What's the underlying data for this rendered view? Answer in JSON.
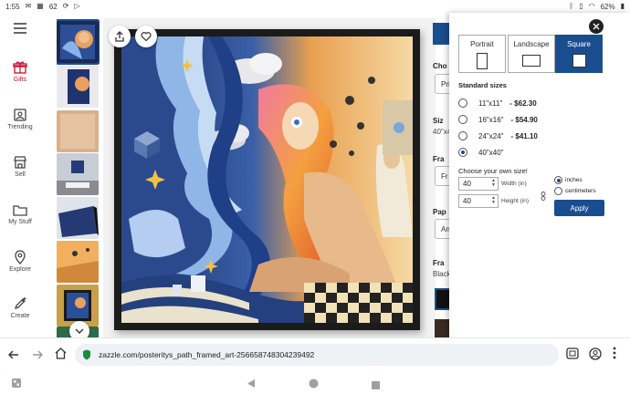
{
  "status": {
    "time": "1:55",
    "notif_count": "62",
    "battery": "62%"
  },
  "rail": {
    "items": [
      {
        "label": "Gifts",
        "icon": "gift-icon"
      },
      {
        "label": "Trending",
        "icon": "trending-icon"
      },
      {
        "label": "Sell",
        "icon": "store-icon"
      },
      {
        "label": "My Stuff",
        "icon": "folder-icon"
      },
      {
        "label": "Explore",
        "icon": "location-icon"
      },
      {
        "label": "Create",
        "icon": "pencil-icon"
      }
    ]
  },
  "product_options": {
    "labels": [
      "Cho",
      "Siz",
      "Fra",
      "Pap",
      "Fra"
    ],
    "values": [
      "Pri",
      "40\"x4",
      "Fr",
      "An",
      "Black"
    ]
  },
  "panel": {
    "orientations": [
      {
        "label": "Portrait",
        "selected": false
      },
      {
        "label": "Landscape",
        "selected": false
      },
      {
        "label": "Square",
        "selected": true
      }
    ],
    "standard_title": "Standard sizes",
    "sizes": [
      {
        "size": "11\"x11\"",
        "price": "- $62.30",
        "selected": false
      },
      {
        "size": "16\"x16\"",
        "price": "- $54.90",
        "selected": false
      },
      {
        "size": "24\"x24\"",
        "price": "- $41.10",
        "selected": false
      },
      {
        "size": "40\"x40\"",
        "price": "",
        "selected": true
      }
    ],
    "own_title": "Choose your own size!",
    "width_value": "40",
    "width_label": "Width (in)",
    "height_value": "40",
    "height_label": "Height (in)",
    "units": [
      {
        "label": "inches",
        "selected": true
      },
      {
        "label": "centimeters",
        "selected": false
      }
    ],
    "apply_label": "Apply"
  },
  "browser": {
    "url": "zazzle.com/posteritys_path_framed_art-256658748304239492"
  },
  "colors": {
    "accent": "#1a4d8f",
    "gifts_red": "#c8102e"
  }
}
